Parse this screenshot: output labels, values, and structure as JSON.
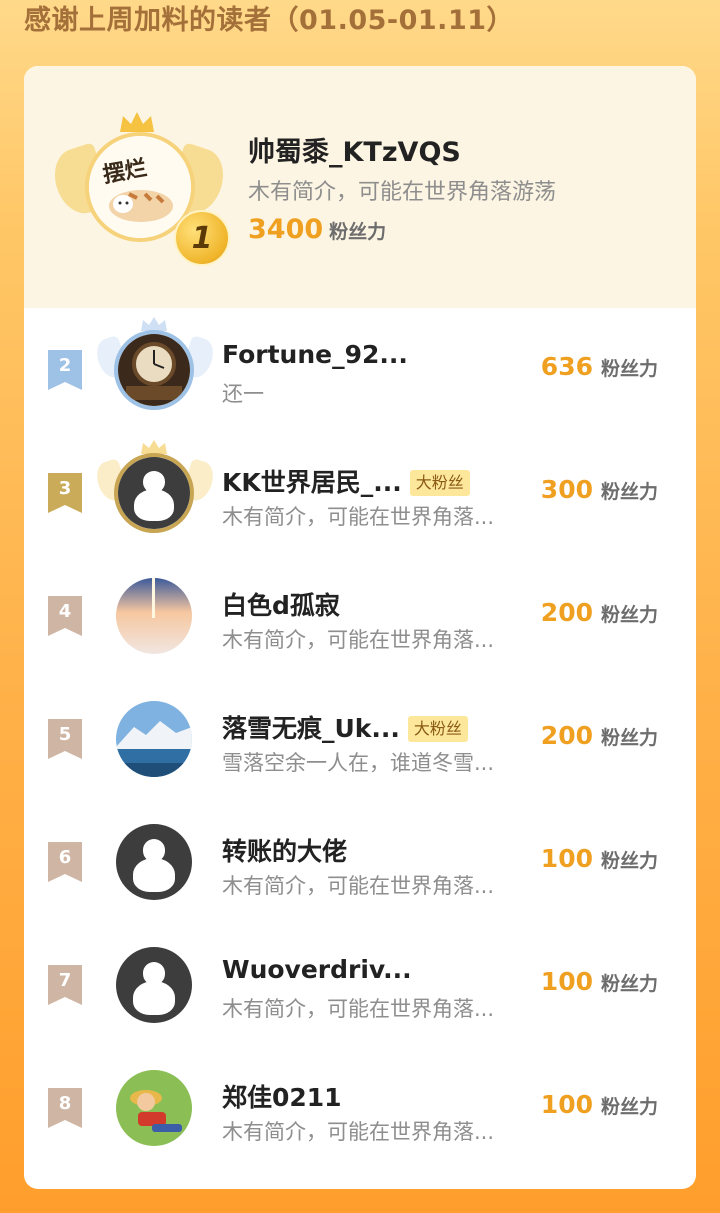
{
  "page": {
    "title": "感谢上周加料的读者（01.05-01.11）"
  },
  "top1": {
    "avatar_text": "摆烂",
    "rank": "1",
    "name": "帅蜀黍_KTzVQS",
    "bio": "木有简介，可能在世界角落游荡",
    "fans_num": "3400",
    "fans_label": "粉丝力"
  },
  "fans_label": "粉丝力",
  "rows": [
    {
      "rank": "2",
      "name": "Fortune_92...",
      "tag": "",
      "bio": "还一",
      "fans": "636",
      "badge_color": "#9ec1e6"
    },
    {
      "rank": "3",
      "name": "KK世界居民_...",
      "tag": "大粉丝",
      "bio": "木有简介，可能在世界角落...",
      "fans": "300",
      "badge_color": "#c9ab5a"
    },
    {
      "rank": "4",
      "name": "白色d孤寂",
      "tag": "",
      "bio": "木有简介，可能在世界角落...",
      "fans": "200",
      "badge_color": "#cfb5a3"
    },
    {
      "rank": "5",
      "name": "落雪无痕_Uk...",
      "tag": "大粉丝",
      "bio": "雪落空余一人在，谁道冬雪...",
      "fans": "200",
      "badge_color": "#cfb5a3"
    },
    {
      "rank": "6",
      "name": "转账的大佬",
      "tag": "",
      "bio": "木有简介，可能在世界角落...",
      "fans": "100",
      "badge_color": "#cfb5a3"
    },
    {
      "rank": "7",
      "name": "Wuoverdriv...",
      "tag": "",
      "bio": "木有简介，可能在世界角落...",
      "fans": "100",
      "badge_color": "#cfb5a3"
    },
    {
      "rank": "8",
      "name": "郑佳0211",
      "tag": "",
      "bio": "木有简介，可能在世界角落...",
      "fans": "100",
      "badge_color": "#cfb5a3"
    }
  ]
}
